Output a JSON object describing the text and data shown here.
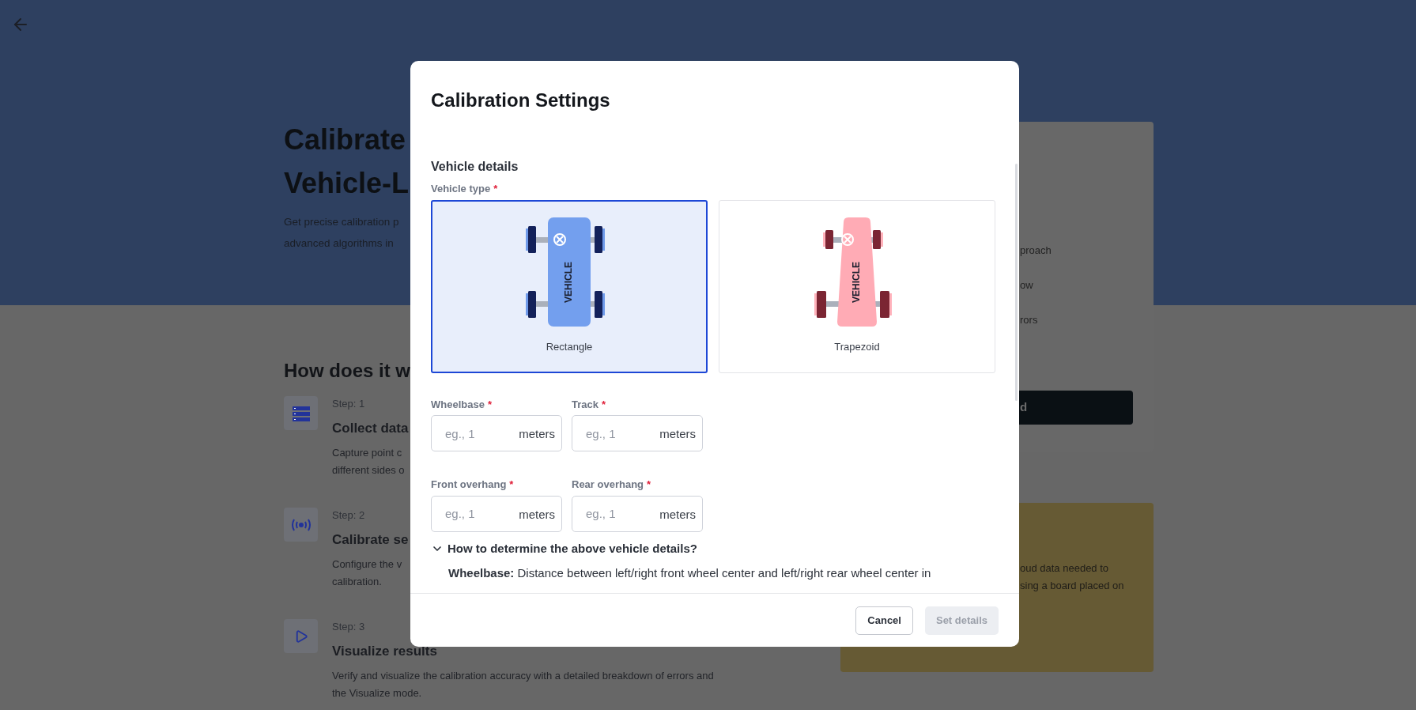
{
  "hero": {
    "title_lines": [
      "Calibrate",
      "Vehicle-L"
    ],
    "description_lines": [
      "Get precise calibration p",
      "advanced algorithms in"
    ]
  },
  "how_it_works": {
    "title": "How does it w",
    "steps": [
      {
        "kind": "data",
        "step": "Step: 1",
        "title": "Collect data",
        "lines": [
          "Capture point c",
          "different sides o"
        ]
      },
      {
        "kind": "sensor",
        "step": "Step: 2",
        "title": "Calibrate se",
        "lines": [
          "Configure the v",
          "calibration."
        ]
      },
      {
        "kind": "play",
        "step": "Step: 3",
        "title": "Visualize results",
        "lines": [
          "Verify and visualize the calibration accuracy with a detailed breakdown of errors and",
          "the Visualize mode."
        ]
      }
    ]
  },
  "side_card": {
    "items": [
      "proach",
      "ow",
      "rors"
    ],
    "button": "d"
  },
  "info_card": {
    "lines": [
      "oud data needed to",
      "sing a board placed on"
    ]
  },
  "modal": {
    "title": "Calibration Settings",
    "section": "Vehicle details",
    "vehicle_type_label": "Vehicle type",
    "vehicle_type_required": "*",
    "vehicle_types": [
      {
        "kind": "rectangle",
        "label": "Rectangle",
        "body_label": "VEHICLE",
        "selected": true
      },
      {
        "kind": "trapezoid",
        "label": "Trapezoid",
        "body_label": "VEHICLE",
        "selected": false
      }
    ],
    "field_rows": [
      [
        {
          "label": "Wheelbase",
          "required_mark": "*",
          "placeholder": "eg., 1",
          "unit": "meters"
        },
        {
          "label": "Track",
          "required_mark": "*",
          "placeholder": "eg., 1",
          "unit": "meters"
        }
      ],
      [
        {
          "label": "Front overhang",
          "required_mark": "*",
          "placeholder": "eg., 1",
          "unit": "meters"
        },
        {
          "label": "Rear overhang",
          "required_mark": "*",
          "placeholder": "eg., 1",
          "unit": "meters"
        }
      ]
    ],
    "help": {
      "label": "How to determine the above vehicle details?",
      "expanded": true,
      "text": "**Wheelbase:** Distance between left/right front wheel center and left/right rear wheel center in"
    },
    "buttons": [
      {
        "label": "Cancel",
        "disabled": false
      },
      {
        "label": "Set details",
        "disabled": true
      }
    ]
  }
}
